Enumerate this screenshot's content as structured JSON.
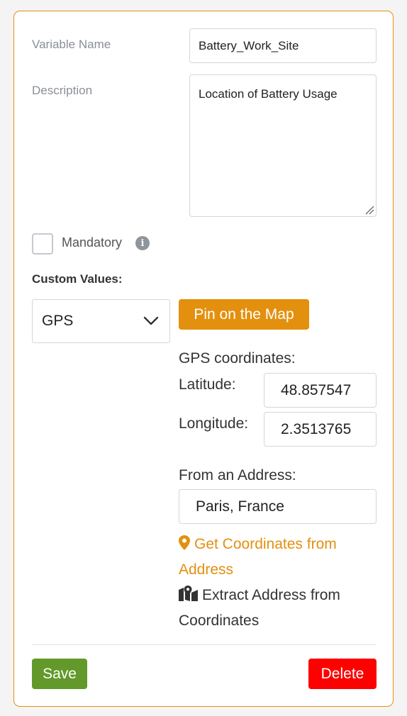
{
  "form": {
    "variable_name_label": "Variable Name",
    "variable_name_value": "Battery_Work_Site",
    "description_label": "Description",
    "description_value": "Location of Battery Usage",
    "mandatory_label": "Mandatory",
    "mandatory_checked": false,
    "info_icon": "info-icon",
    "custom_values_label": "Custom Values:"
  },
  "custom_values": {
    "type_select_value": "GPS",
    "pin_button_label": "Pin on the Map",
    "gps_coordinates_label": "GPS coordinates:",
    "latitude_label": "Latitude:",
    "latitude_value": "48.857547",
    "longitude_label": "Longitude:",
    "longitude_value": "2.3513765",
    "from_address_label": "From an Address:",
    "address_value": "Paris, France",
    "get_coordinates_link": "Get Coordinates from Address",
    "get_coordinates_icon": "map-marker-icon",
    "extract_address_link": "Extract Address from Coordinates",
    "extract_address_icon": "map-icon"
  },
  "footer": {
    "save_label": "Save",
    "delete_label": "Delete"
  },
  "colors": {
    "accent": "#e3900f",
    "save": "#62992a",
    "delete": "#ff0000",
    "border": "#e3900f"
  }
}
